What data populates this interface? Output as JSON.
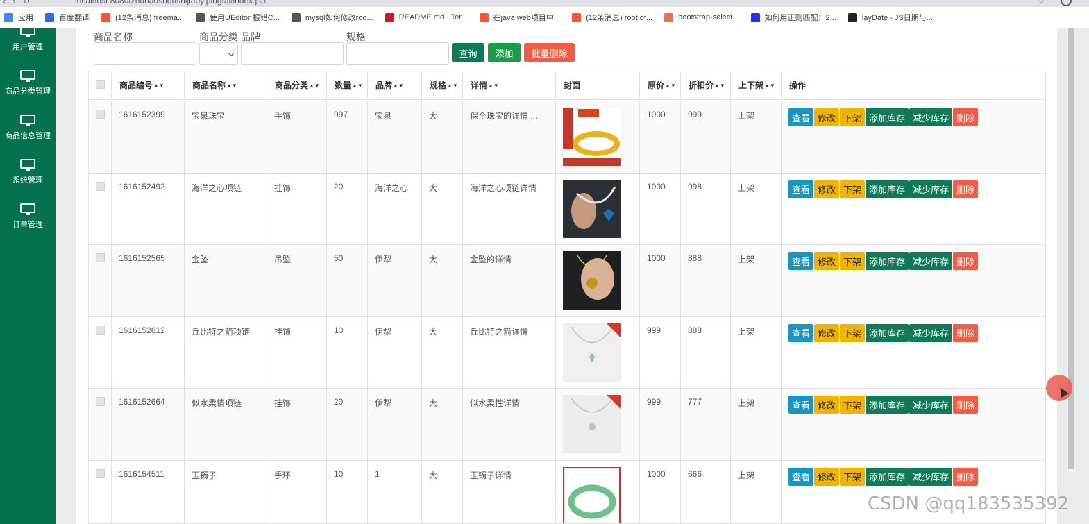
{
  "browser": {
    "url": "localhost:8080/zhubaoshoushijiaoyipingtai/index.jsp",
    "bookmarks": [
      {
        "label": "应用",
        "icon": "apps-grid-icon",
        "color": "#4285f4"
      },
      {
        "label": "百度翻译",
        "icon": "baidu-translate-icon",
        "color": "#2b6de5"
      },
      {
        "label": "(12条消息) freema...",
        "icon": "csdn-icon",
        "color": "#fc5531"
      },
      {
        "label": "使用UEditor 报错C...",
        "icon": "generic-site-icon",
        "color": "#555555"
      },
      {
        "label": "mysql如何修改roo...",
        "icon": "generic-site-icon",
        "color": "#555555"
      },
      {
        "label": "README.md · Ter...",
        "icon": "gitee-icon",
        "color": "#c71d23"
      },
      {
        "label": "在java web项目中...",
        "icon": "csdn-icon",
        "color": "#fc5531"
      },
      {
        "label": "(12条消息) root of...",
        "icon": "csdn-icon",
        "color": "#fc5531"
      },
      {
        "label": "bootstrap-select...",
        "icon": "jianshu-icon",
        "color": "#ea6f5a"
      },
      {
        "label": "如何用正则匹配：2...",
        "icon": "baidu-paw-icon",
        "color": "#2932e1"
      },
      {
        "label": "layDate - JS日期与...",
        "icon": "layui-icon",
        "color": "#222222"
      }
    ]
  },
  "sidebar": {
    "items": [
      {
        "label": "用户管理"
      },
      {
        "label": "商品分类管理"
      },
      {
        "label": "商品信息管理"
      },
      {
        "label": "系统管理"
      },
      {
        "label": "订单管理"
      }
    ]
  },
  "filters": {
    "name_label": "商品名称",
    "category_label": "商品分类",
    "brand_label": "品牌",
    "spec_label": "规格",
    "query_button": "查询",
    "add_button": "添加",
    "batch_delete_button": "批量删除"
  },
  "colors": {
    "sidebar": "#03714e",
    "query": "#0f7a57",
    "add": "#1c9b48",
    "batch_delete": "#f05c46"
  },
  "table": {
    "headers": {
      "id": "商品编号",
      "name": "商品名称",
      "category": "商品分类",
      "qty": "数量",
      "brand": "品牌",
      "spec": "规格",
      "detail": "详情",
      "cover": "封面",
      "price": "原价",
      "discount": "折扣价",
      "status": "上下架",
      "ops": "操作"
    },
    "actions": {
      "view": "查看",
      "edit": "修改",
      "off": "下架",
      "add_stock": "添加库存",
      "reduce_stock": "减少库存",
      "delete": "删除"
    },
    "rows": [
      {
        "id": "1616152399",
        "name": "宝泉珠宝",
        "category": "手饰",
        "qty": "997",
        "brand": "宝泉",
        "spec": "大",
        "detail": "保全珠宝的详情 ...",
        "price": "1000",
        "discount": "999",
        "status": "上架",
        "cover": "gold-bracelet-image"
      },
      {
        "id": "1616152492",
        "name": "海洋之心项链",
        "category": "挂饰",
        "qty": "20",
        "brand": "海洋之心",
        "spec": "大",
        "detail": "海洋之心项链详情",
        "price": "1000",
        "discount": "998",
        "status": "上架",
        "cover": "blue-heart-necklace-image"
      },
      {
        "id": "1616152565",
        "name": "金坠",
        "category": "吊坠",
        "qty": "50",
        "brand": "伊犁",
        "spec": "大",
        "detail": "金坠的详情",
        "price": "1000",
        "discount": "888",
        "status": "上架",
        "cover": "gold-pendant-image"
      },
      {
        "id": "1616152612",
        "name": "丘比特之箭项链",
        "category": "挂饰",
        "qty": "10",
        "brand": "伊犁",
        "spec": "大",
        "detail": "丘比特之箭详情",
        "price": "999",
        "discount": "888",
        "status": "上架",
        "cover": "silver-necklace-image"
      },
      {
        "id": "1616152664",
        "name": "似水柔情项链",
        "category": "挂饰",
        "qty": "20",
        "brand": "伊犁",
        "spec": "大",
        "detail": "似水柔性详情",
        "price": "999",
        "discount": "777",
        "status": "上架",
        "cover": "silver-pendant-image"
      },
      {
        "id": "1616154511",
        "name": "玉镯子",
        "category": "手环",
        "qty": "10",
        "brand": "1",
        "spec": "大",
        "detail": "玉镯子详情",
        "price": "1000",
        "discount": "666",
        "status": "上架",
        "cover": "jade-bracelet-image"
      }
    ]
  },
  "watermark": "CSDN @qq183535392"
}
